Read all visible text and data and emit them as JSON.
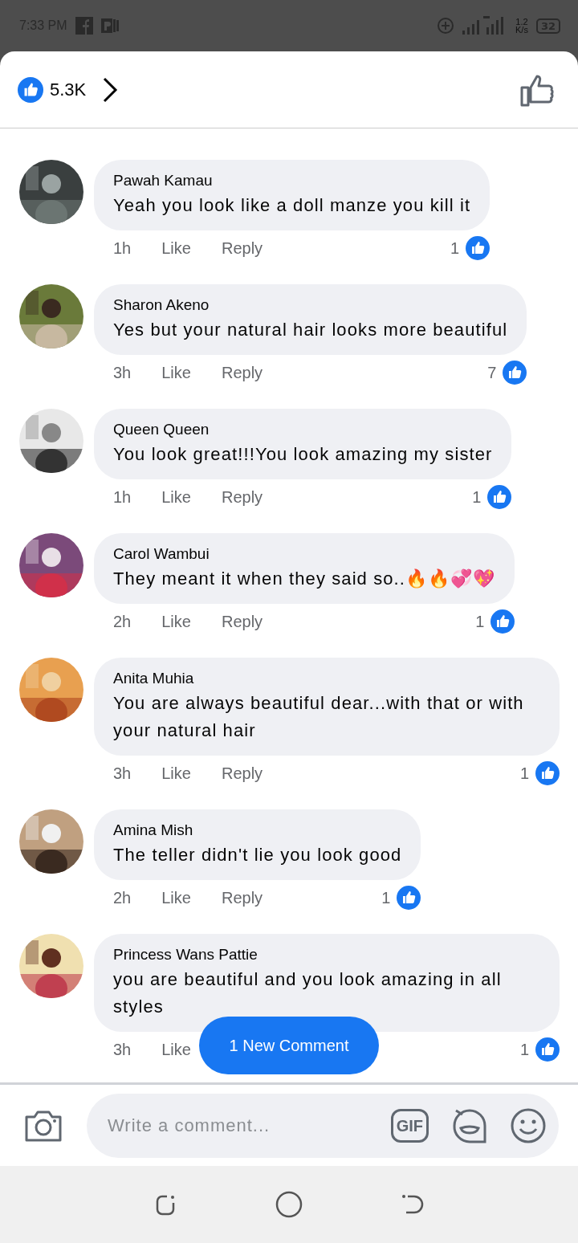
{
  "status_bar": {
    "time": "7:33 PM",
    "speed_value": "1.2",
    "speed_unit": "K/s",
    "battery": "32"
  },
  "header": {
    "reaction_count": "5.3K"
  },
  "comments": [
    {
      "name": "Pawah Kamau",
      "text": "Yeah you look like a doll manze you kill it",
      "time": "1h",
      "like": "Like",
      "reply": "Reply",
      "likes": "1"
    },
    {
      "name": "Sharon Akeno",
      "text": "Yes but your natural hair looks more beautiful",
      "time": "3h",
      "like": "Like",
      "reply": "Reply",
      "likes": "7"
    },
    {
      "name": "Queen Queen",
      "text": "You look great!!!You look amazing my sister",
      "time": "1h",
      "like": "Like",
      "reply": "Reply",
      "likes": "1"
    },
    {
      "name": "Carol Wambui",
      "text": "They meant it when they said so..🔥🔥💞💖",
      "time": "2h",
      "like": "Like",
      "reply": "Reply",
      "likes": "1"
    },
    {
      "name": "Anita Muhia",
      "text": "You are always beautiful dear...with that or with your natural hair",
      "time": "3h",
      "like": "Like",
      "reply": "Reply",
      "likes": "1"
    },
    {
      "name": "Amina Mish",
      "text": "The teller didn't lie you look good",
      "time": "2h",
      "like": "Like",
      "reply": "Reply",
      "likes": "1"
    },
    {
      "name": "Princess Wans Pattie",
      "text": "you are beautiful and you look amazing in all styles",
      "time": "3h",
      "like": "Like",
      "likes": "1"
    }
  ],
  "new_comment_button": "1 New Comment",
  "composer": {
    "placeholder": "Write a comment...",
    "gif": "GIF"
  }
}
